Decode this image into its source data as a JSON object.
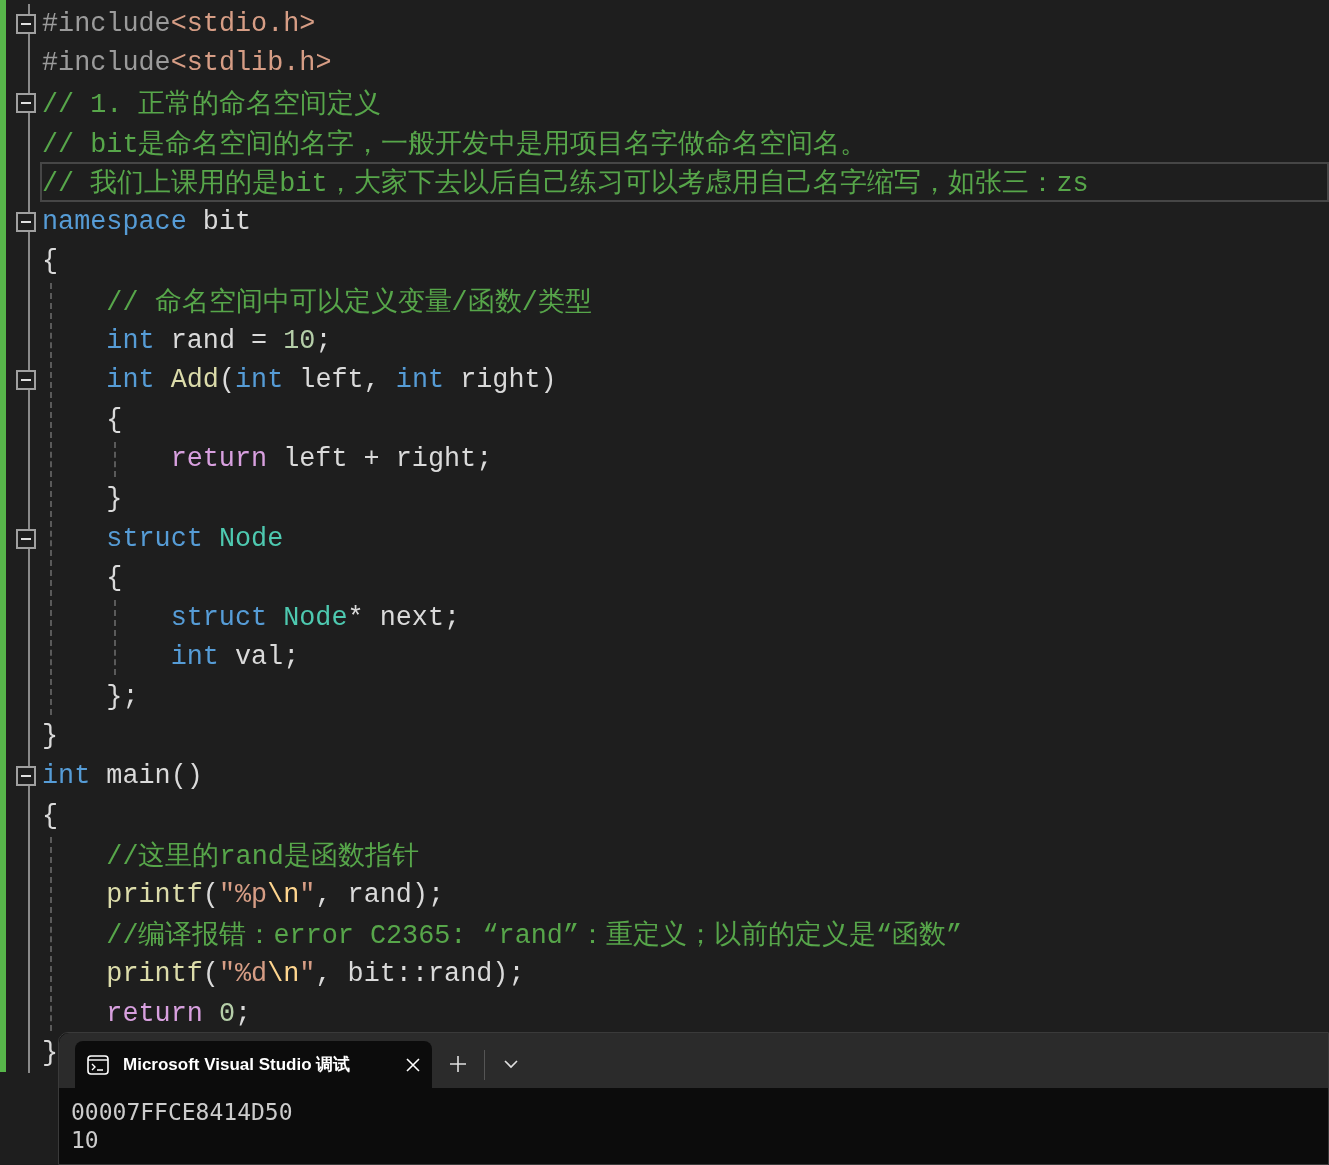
{
  "editor": {
    "lines": [
      {
        "foldable": true,
        "current": false,
        "tokens": [
          {
            "kind": "preproc",
            "text": "#include"
          },
          {
            "kind": "string",
            "text": "<stdio.h>"
          }
        ]
      },
      {
        "foldable": false,
        "current": false,
        "tokens": [
          {
            "kind": "preproc",
            "text": "#include"
          },
          {
            "kind": "string",
            "text": "<stdlib.h>"
          }
        ]
      },
      {
        "foldable": true,
        "current": false,
        "tokens": [
          {
            "kind": "comment",
            "text": "// 1. 正常的命名空间定义"
          }
        ]
      },
      {
        "foldable": false,
        "current": false,
        "tokens": [
          {
            "kind": "comment",
            "text": "// bit是命名空间的名字，一般开发中是用项目名字做命名空间名。"
          }
        ]
      },
      {
        "foldable": false,
        "current": true,
        "tokens": [
          {
            "kind": "comment",
            "text": "// 我们上课用的是bit，大家下去以后自己练习可以考虑用自己名字缩写，如张三：zs"
          }
        ]
      },
      {
        "foldable": true,
        "current": false,
        "tokens": [
          {
            "kind": "keyword",
            "text": "namespace"
          },
          {
            "kind": "plain",
            "text": " bit"
          }
        ]
      },
      {
        "foldable": false,
        "current": false,
        "tokens": [
          {
            "kind": "plain",
            "text": "{"
          }
        ],
        "children": [
          {
            "foldable": false,
            "current": false,
            "tokens": [
              {
                "kind": "comment",
                "text": "// 命名空间中可以定义变量/函数/类型"
              }
            ]
          },
          {
            "foldable": false,
            "current": false,
            "tokens": [
              {
                "kind": "keyword",
                "text": "int"
              },
              {
                "kind": "plain",
                "text": " rand = "
              },
              {
                "kind": "number",
                "text": "10"
              },
              {
                "kind": "plain",
                "text": ";"
              }
            ]
          },
          {
            "foldable": true,
            "current": false,
            "tokens": [
              {
                "kind": "keyword",
                "text": "int "
              },
              {
                "kind": "function",
                "text": "Add"
              },
              {
                "kind": "plain",
                "text": "("
              },
              {
                "kind": "keyword",
                "text": "int"
              },
              {
                "kind": "plain",
                "text": " left, "
              },
              {
                "kind": "keyword",
                "text": "int"
              },
              {
                "kind": "plain",
                "text": " right)"
              }
            ]
          },
          {
            "foldable": false,
            "current": false,
            "tokens": [
              {
                "kind": "plain",
                "text": "{"
              }
            ],
            "children": [
              {
                "foldable": false,
                "current": false,
                "tokens": [
                  {
                    "kind": "control",
                    "text": "return"
                  },
                  {
                    "kind": "plain",
                    "text": " left + right;"
                  }
                ]
              }
            ]
          },
          {
            "foldable": false,
            "current": false,
            "tokens": [
              {
                "kind": "plain",
                "text": "}"
              }
            ]
          },
          {
            "foldable": true,
            "current": false,
            "tokens": [
              {
                "kind": "keyword",
                "text": "struct "
              },
              {
                "kind": "type",
                "text": "Node"
              }
            ]
          },
          {
            "foldable": false,
            "current": false,
            "tokens": [
              {
                "kind": "plain",
                "text": "{"
              }
            ],
            "children": [
              {
                "foldable": false,
                "current": false,
                "tokens": [
                  {
                    "kind": "keyword",
                    "text": "struct "
                  },
                  {
                    "kind": "type",
                    "text": "Node"
                  },
                  {
                    "kind": "plain",
                    "text": "* next;"
                  }
                ]
              },
              {
                "foldable": false,
                "current": false,
                "tokens": [
                  {
                    "kind": "keyword",
                    "text": "int"
                  },
                  {
                    "kind": "plain",
                    "text": " val;"
                  }
                ]
              }
            ]
          },
          {
            "foldable": false,
            "current": false,
            "tokens": [
              {
                "kind": "plain",
                "text": "};"
              }
            ]
          }
        ]
      },
      {
        "foldable": false,
        "current": false,
        "tokens": [
          {
            "kind": "plain",
            "text": "}"
          }
        ]
      },
      {
        "foldable": true,
        "current": false,
        "tokens": [
          {
            "kind": "keyword",
            "text": "int"
          },
          {
            "kind": "plain",
            "text": " main()"
          }
        ]
      },
      {
        "foldable": false,
        "current": false,
        "tokens": [
          {
            "kind": "plain",
            "text": "{"
          }
        ],
        "children": [
          {
            "foldable": false,
            "current": false,
            "tokens": [
              {
                "kind": "comment",
                "text": "//这里的rand是函数指针"
              }
            ]
          },
          {
            "foldable": false,
            "current": false,
            "tokens": [
              {
                "kind": "function",
                "text": "printf"
              },
              {
                "kind": "plain",
                "text": "("
              },
              {
                "kind": "string",
                "text": "\"%p"
              },
              {
                "kind": "escape",
                "text": "\\n"
              },
              {
                "kind": "string",
                "text": "\""
              },
              {
                "kind": "plain",
                "text": ", rand);"
              }
            ]
          },
          {
            "foldable": false,
            "current": false,
            "tokens": [
              {
                "kind": "comment",
                "text": "//编译报错：error C2365: “rand”：重定义；以前的定义是“函数”"
              }
            ]
          },
          {
            "foldable": false,
            "current": false,
            "tokens": [
              {
                "kind": "function",
                "text": "printf"
              },
              {
                "kind": "plain",
                "text": "("
              },
              {
                "kind": "string",
                "text": "\"%d"
              },
              {
                "kind": "escape",
                "text": "\\n"
              },
              {
                "kind": "string",
                "text": "\""
              },
              {
                "kind": "plain",
                "text": ", bit::rand);"
              }
            ]
          },
          {
            "foldable": false,
            "current": false,
            "tokens": [
              {
                "kind": "control",
                "text": "return "
              },
              {
                "kind": "number",
                "text": "0"
              },
              {
                "kind": "plain",
                "text": ";"
              }
            ]
          }
        ]
      },
      {
        "foldable": false,
        "current": false,
        "tokens": [
          {
            "kind": "plain",
            "text": "}"
          }
        ]
      }
    ]
  },
  "terminal": {
    "tab_title": "Microsoft Visual Studio 调试",
    "output": [
      "00007FFCE8414D50",
      "10"
    ]
  }
}
